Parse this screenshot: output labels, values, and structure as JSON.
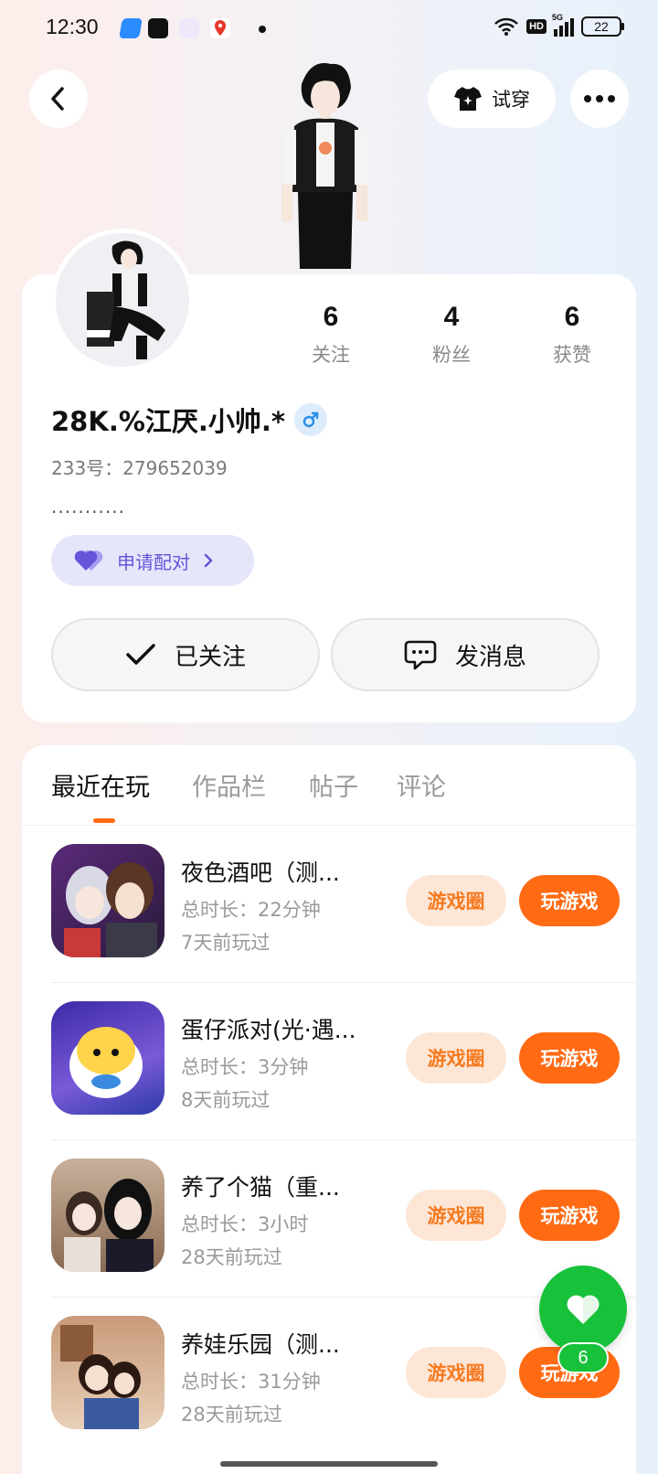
{
  "status_bar": {
    "time": "12:30",
    "hd": "HD",
    "signal": "5G",
    "battery": "22"
  },
  "header": {
    "try_on_label": "试穿"
  },
  "profile": {
    "stats": [
      {
        "value": "6",
        "label": "关注"
      },
      {
        "value": "4",
        "label": "粉丝"
      },
      {
        "value": "6",
        "label": "获赞"
      }
    ],
    "nickname": "28K.%江厌.小帅.*",
    "uid": "233号：279652039",
    "bio": "...........",
    "match_label": "申请配对",
    "followed_label": "已关注",
    "message_label": "发消息"
  },
  "tabs": [
    "最近在玩",
    "作品栏",
    "帖子",
    "评论"
  ],
  "games": [
    {
      "title": "夜色酒吧（测...",
      "duration": "总时长：22分钟",
      "last_played": "7天前玩过"
    },
    {
      "title": "蛋仔派对(光·遇...",
      "duration": "总时长：3分钟",
      "last_played": "8天前玩过"
    },
    {
      "title": "养了个猫（重...",
      "duration": "总时长：3小时",
      "last_played": "28天前玩过"
    },
    {
      "title": "养娃乐园（测...",
      "duration": "总时长：31分钟",
      "last_played": "28天前玩过"
    }
  ],
  "game_circle_label": "游戏圈",
  "play_label": "玩游戏",
  "like_count": "6",
  "colors": {
    "accent": "#ff6a13",
    "like_green": "#17c13a",
    "match_purple": "#6655d8"
  }
}
